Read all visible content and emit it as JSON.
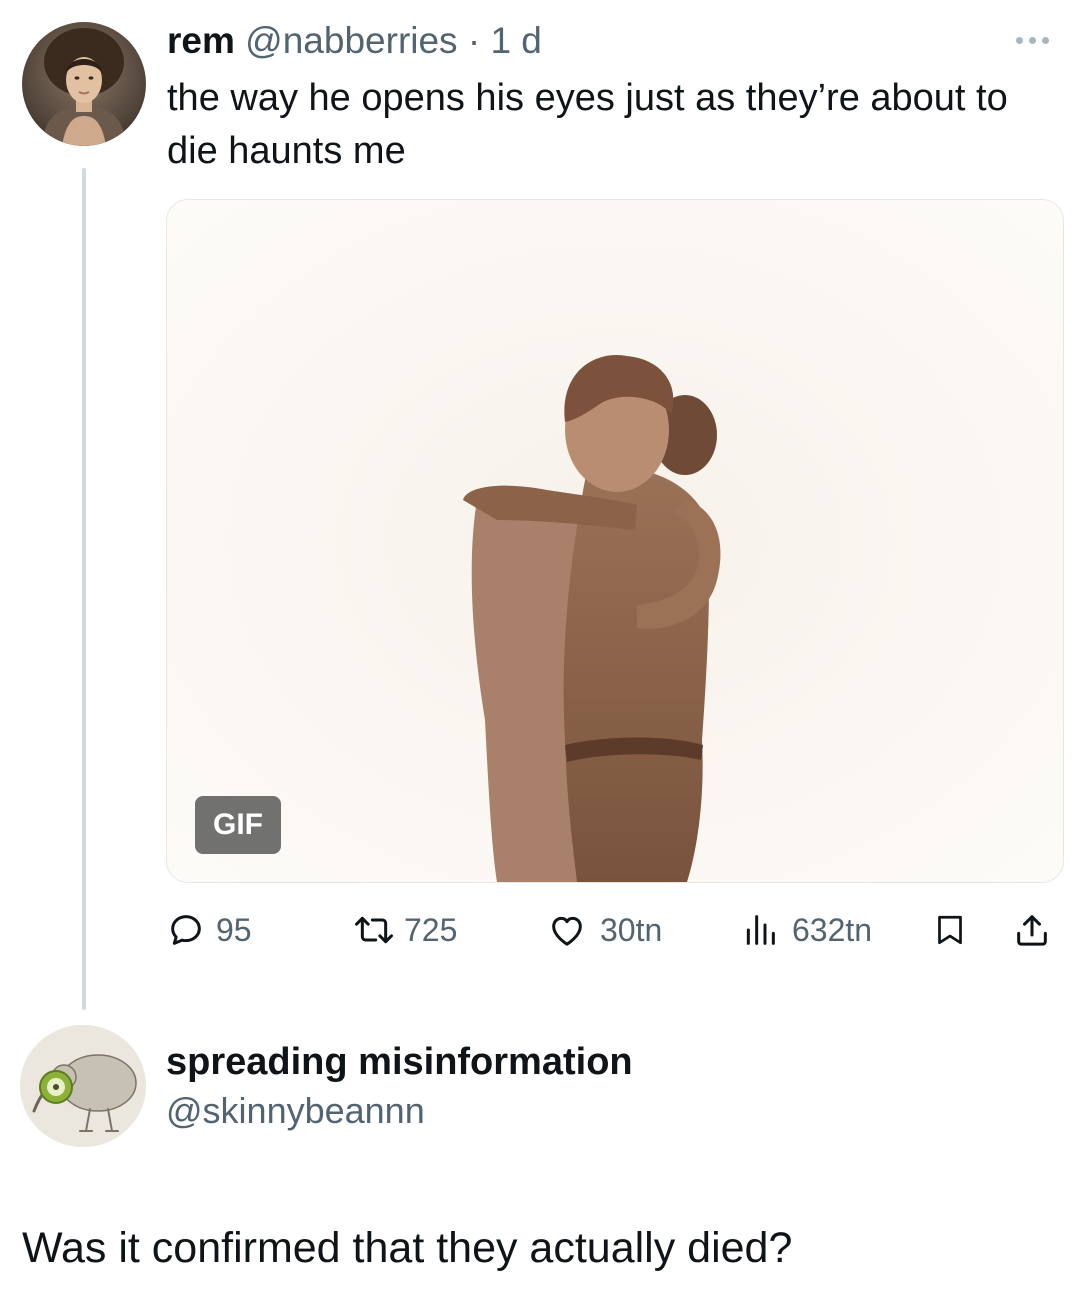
{
  "tweet": {
    "author_name": "rem",
    "author_handle": "@nabberries",
    "time_sep": " · ",
    "time": "1 d",
    "text": "the way he opens his eyes just as they’re about to die haunts me",
    "media_badge": "GIF",
    "stats": {
      "replies": "95",
      "retweets": "725",
      "likes": "30tn",
      "views": "632tn"
    },
    "icons": [
      "reply-icon",
      "retweet-icon",
      "like-icon",
      "views-icon",
      "bookmark-icon",
      "share-icon",
      "more-icon"
    ]
  },
  "reply": {
    "author_name": "spreading misinformation",
    "author_handle": "@skinnybeannn",
    "text": "Was it confirmed that they actually died?"
  },
  "colors": {
    "text_primary": "#0f1419",
    "text_secondary": "#536471",
    "thread_line": "#cfd9de",
    "media_tone": "#a27c60"
  }
}
